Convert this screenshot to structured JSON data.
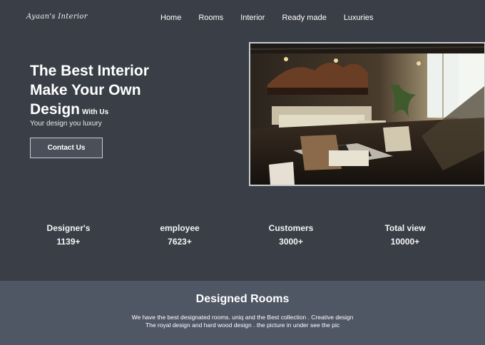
{
  "header": {
    "logo": "Ayaan's Interior",
    "nav": [
      "Home",
      "Rooms",
      "Interior",
      "Ready made",
      "Luxuries"
    ]
  },
  "hero": {
    "title_lines": [
      "The Best Interior",
      "Make Your Own",
      "Design"
    ],
    "title_suffix": "With Us",
    "subtitle": "Your design you luxury",
    "cta_label": "Contact Us"
  },
  "stats": [
    {
      "label": "Designer's",
      "value": "1139+"
    },
    {
      "label": "employee",
      "value": "7623+"
    },
    {
      "label": "Customers",
      "value": "3000+"
    },
    {
      "label": "Total view",
      "value": "10000+"
    }
  ],
  "rooms_section": {
    "title": "Designed Rooms",
    "description_lines": [
      "We have the best designated rooms. uniq and the Best collection . Creative design",
      "The royal design and hard wood design . the picture in under see the pic"
    ]
  },
  "colors": {
    "background": "#3a3f47",
    "section_background": "#4f5664",
    "button_background": "#4a505a",
    "text": "#ffffff"
  }
}
